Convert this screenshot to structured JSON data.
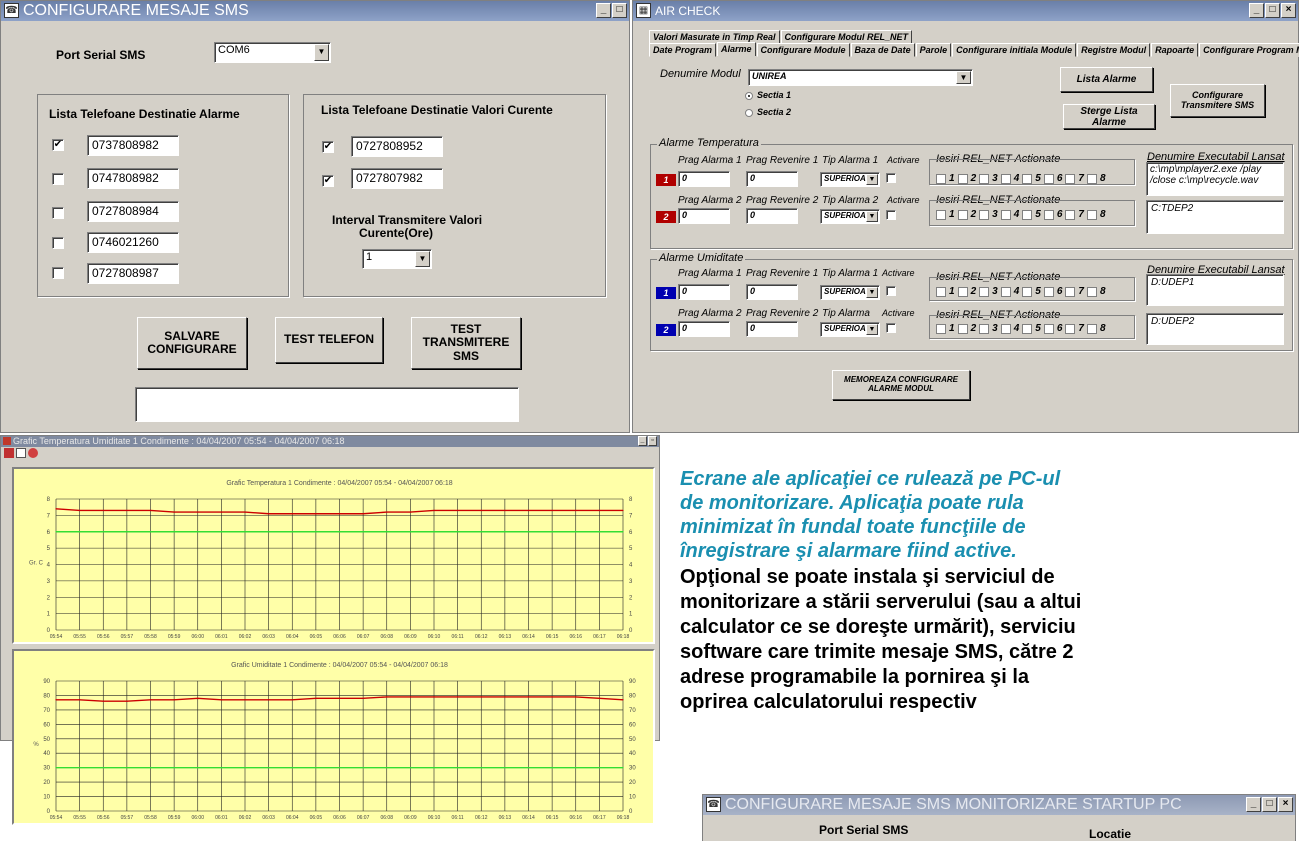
{
  "sms_window": {
    "title": "CONFIGURARE MESAJE SMS",
    "port_label": "Port Serial SMS",
    "port_value": "COM6",
    "alarm_group_title": "Lista Telefoane Destinatie Alarme",
    "alarm_phones": [
      {
        "checked": "✔",
        "number": "0737808982"
      },
      {
        "checked": "",
        "number": "0747808982"
      },
      {
        "checked": "",
        "number": "0727808984"
      },
      {
        "checked": "",
        "number": "0746021260"
      },
      {
        "checked": "",
        "number": "0727808987"
      }
    ],
    "current_group_title": "Lista Telefoane Destinatie Valori Curente",
    "current_phones": [
      {
        "checked": "✔",
        "number": "0727808952"
      },
      {
        "checked": "✔",
        "number": "0727807982"
      }
    ],
    "interval_label_1": "Interval Transmitere Valori",
    "interval_label_2": "Curente(Ore)",
    "interval_value": "1",
    "btn_save": "SALVARE\nCONFIGURARE",
    "btn_test_phone": "TEST TELEFON",
    "btn_test_sms": "TEST\nTRANSMITERE\nSMS"
  },
  "air_window": {
    "title": "AIR CHECK",
    "tabs_row1": [
      "Valori Masurate in Timp Real",
      "Configurare Modul REL_NET"
    ],
    "tabs_row2": [
      "Date Program",
      "Alarme",
      "Configurare Module",
      "Baza de Date",
      "Parole",
      "Configurare initiala Module",
      "Registre Modul",
      "Rapoarte",
      "Configurare Program Monitorizare"
    ],
    "module_label": "Denumire Modul",
    "module_value": "UNIREA",
    "sectia1": "Sectia 1",
    "sectia2": "Sectia 2",
    "btn_lista": "Lista Alarme",
    "btn_sterge": "Sterge Lista Alarme",
    "btn_config_sms": "Configurare\nTransmitere SMS",
    "temp_group": "Alarme Temperatura",
    "hum_group": "Alarme Umiditate",
    "h_prag1": "Prag Alarma 1",
    "h_rev1": "Prag Revenire 1",
    "h_tip1": "Tip Alarma 1",
    "h_activ": "Activare",
    "h_prag2": "Prag Alarma 2",
    "h_rev2": "Prag Revenire 2",
    "h_tip2": "Tip Alarma 2",
    "h_tip2h": "Tip Alarma",
    "h_iesiri": "Iesiri REL_NET Actionate",
    "h_exe": "Denumire Executabil Lansat",
    "zero": "0",
    "tip_value": "SUPERIOARA",
    "rel_nums": [
      "1",
      "2",
      "3",
      "4",
      "5",
      "6",
      "7",
      "8"
    ],
    "exe_t1": "c:\\mp\\mplayer2.exe /play /close c:\\mp\\recycle.wav",
    "exe_t2": "C:TDEP2",
    "exe_h1": "D:UDEP1",
    "exe_h2": "D:UDEP2",
    "btn_memo": "MEMOREAZA CONFIGURARE\nALARME MODUL"
  },
  "graph_window": {
    "title": "Grafic Temperatura Umiditate  1  Condimente :  04/04/2007 05:54 - 04/04/2007 06:18",
    "chart1_title": "Grafic Temperatura 1 Condimente : 04/04/2007 05:54 - 04/04/2007 06:18",
    "chart2_title": "Grafic Umiditate 1 Condimente : 04/04/2007 05:54 - 04/04/2007 06:18",
    "ylabel1": "Gr. C",
    "ylabel2": "%"
  },
  "chart_data": [
    {
      "type": "line",
      "title": "Grafic Temperatura 1 Condimente : 04/04/2007 05:54 - 04/04/2007 06:18",
      "ylabel": "Gr. C",
      "ylim": [
        0,
        8
      ],
      "yticks": [
        "0",
        "1",
        "2",
        "3",
        "4",
        "5",
        "6",
        "7",
        "8"
      ],
      "categories": [
        "05:54",
        "05:55",
        "05:56",
        "05:57",
        "05:58",
        "05:59",
        "06:00",
        "06:01",
        "06:02",
        "06:03",
        "06:04",
        "06:05",
        "06:06",
        "06:07",
        "06:08",
        "06:09",
        "06:10",
        "06:11",
        "06:12",
        "06:13",
        "06:14",
        "06:15",
        "06:16",
        "06:17",
        "06:18"
      ],
      "series": [
        {
          "color": "#cc0000",
          "values": [
            7.4,
            7.3,
            7.3,
            7.3,
            7.3,
            7.2,
            7.2,
            7.2,
            7.2,
            7.1,
            7.1,
            7.1,
            7.1,
            7.1,
            7.2,
            7.2,
            7.3,
            7.3,
            7.3,
            7.3,
            7.3,
            7.3,
            7.3,
            7.3,
            7.3
          ]
        },
        {
          "color": "#33dd33",
          "values": [
            6,
            6,
            6,
            6,
            6,
            6,
            6,
            6,
            6,
            6,
            6,
            6,
            6,
            6,
            6,
            6,
            6,
            6,
            6,
            6,
            6,
            6,
            6,
            6,
            6
          ]
        }
      ]
    },
    {
      "type": "line",
      "title": "Grafic Umiditate 1 Condimente : 04/04/2007 05:54 - 04/04/2007 06:18",
      "ylabel": "%",
      "ylim": [
        0,
        90
      ],
      "yticks": [
        "0",
        "10",
        "20",
        "30",
        "40",
        "50",
        "60",
        "70",
        "80",
        "90"
      ],
      "categories": [
        "05:54",
        "05:55",
        "05:56",
        "05:57",
        "05:58",
        "05:59",
        "06:00",
        "06:01",
        "06:02",
        "06:03",
        "06:04",
        "06:05",
        "06:06",
        "06:07",
        "06:08",
        "06:09",
        "06:10",
        "06:11",
        "06:12",
        "06:13",
        "06:14",
        "06:15",
        "06:16",
        "06:17",
        "06:18"
      ],
      "series": [
        {
          "color": "#cc0000",
          "values": [
            77,
            77,
            76,
            76,
            77,
            77,
            78,
            77,
            77,
            77,
            77,
            78,
            78,
            78,
            79,
            79,
            79,
            79,
            79,
            79,
            79,
            79,
            79,
            78,
            77
          ]
        },
        {
          "color": "#33dd33",
          "values": [
            30,
            30,
            30,
            30,
            30,
            30,
            30,
            30,
            30,
            30,
            30,
            30,
            30,
            30,
            30,
            30,
            30,
            30,
            30,
            30,
            30,
            30,
            30,
            30,
            30
          ]
        }
      ]
    }
  ],
  "caption": {
    "italic_lines": [
      "Ecrane ale aplicaţiei ce rulează pe PC-ul",
      "de    monitorizare.   Aplicaţia   poate   rula",
      "minimizat   în   fundal   toate   funcţiile   de",
      "înregistrare şi alarmare fiind active."
    ],
    "bold_lines": [
      "Opţional se poate instala şi serviciul de",
      "monitorizare a stării serverului (sau a altui",
      "calculator ce se doreşte urmărit), serviciu",
      "software care trimite mesaje SMS, către 2",
      "adrese   programabile   la   pornirea   şi   la",
      "oprirea calculatorului respectiv"
    ]
  },
  "startup_window": {
    "title": "CONFIGURARE MESAJE SMS MONITORIZARE STARTUP PC",
    "port_label": "Port Serial SMS",
    "loc_label": "Locatie"
  },
  "colors": {
    "caption_italic": "#1a8fb0",
    "red_line": "#cc0000",
    "green_line": "#33dd33",
    "chart_bg": "#ffffa8"
  }
}
